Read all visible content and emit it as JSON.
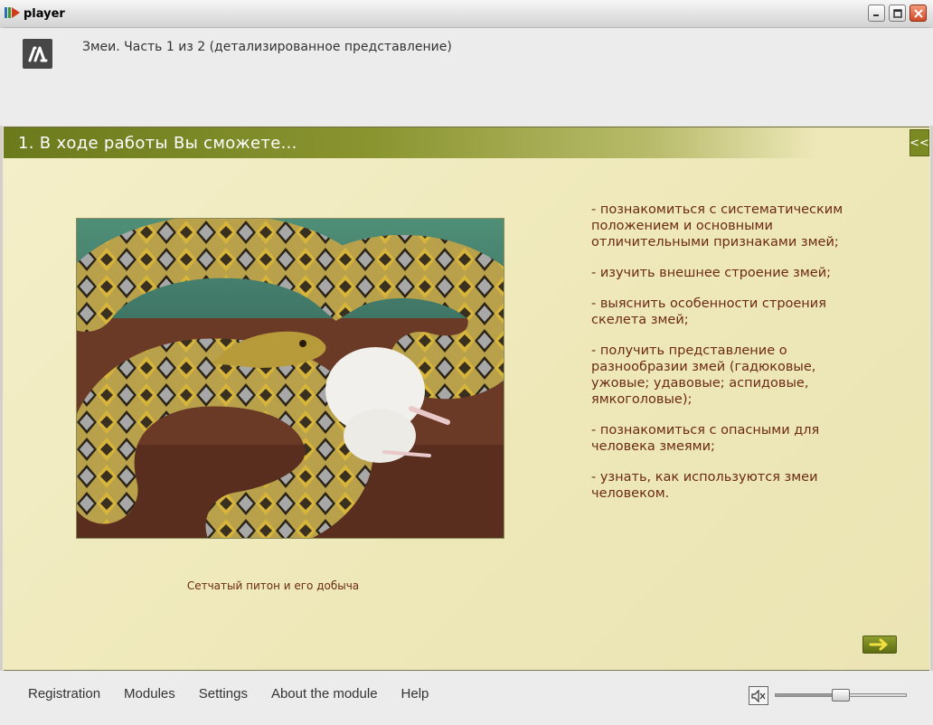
{
  "window": {
    "title": "player"
  },
  "header": {
    "course_title": "Змеи. Часть 1 из 2 (детализированное представление)"
  },
  "section": {
    "title": "1. В ходе работы Вы сможете...",
    "collapse_label": "<<"
  },
  "photo": {
    "caption": "Сетчатый питон и его добыча"
  },
  "goals": [
    "- познакомиться с систематическим положением и основными отличительными признаками змей;",
    "- изучить внешнее строение змей;",
    "- выяснить особенности строения скелета змей;",
    "- получить представление о разнообразии змей (гадюковые, ужовые; удавовые; аспидовые, ямкоголовые);",
    "- познакомиться с опасными для человека змеями;",
    "- узнать, как используются змеи человеком."
  ],
  "footer": {
    "menu": [
      "Registration",
      "Modules",
      "Settings",
      "About the module",
      "Help"
    ],
    "volume": 0.5
  },
  "colors": {
    "accent": "#7c8a24",
    "text": "#6b2b14",
    "content_bg": "#f0ebbf"
  }
}
